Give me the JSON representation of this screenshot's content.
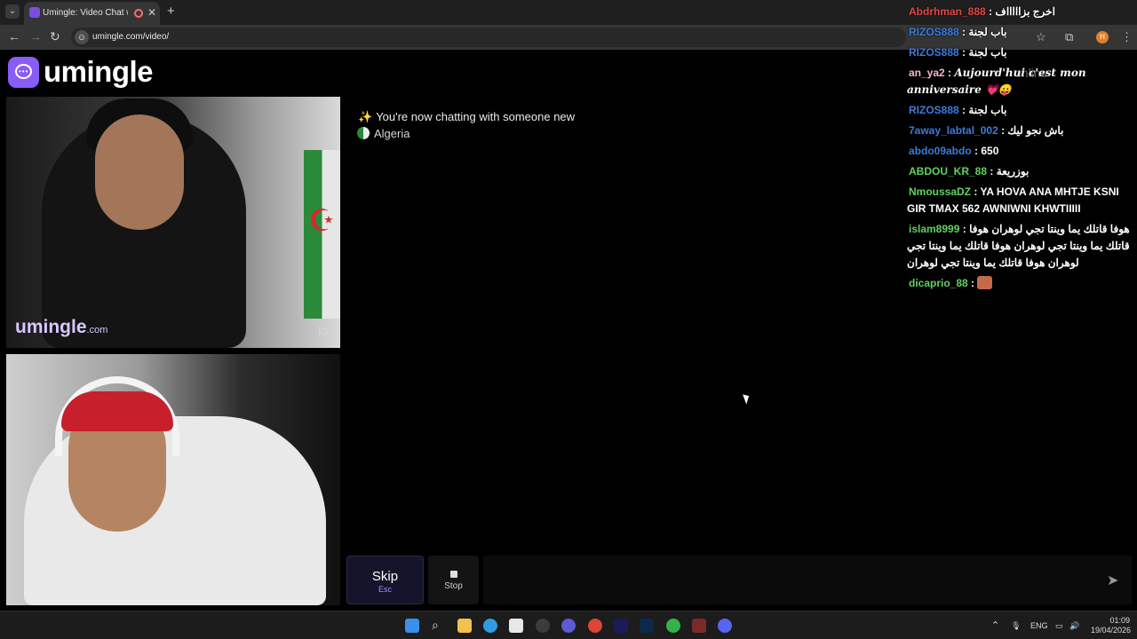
{
  "browser": {
    "tab_title": "Umingle: Video Chat with S",
    "url": "umingle.com/video/",
    "profile_initial": "H"
  },
  "page": {
    "logo_text": "umingle",
    "online_label": "online",
    "video_brand": "umingle",
    "video_brand_suffix": ".com",
    "chat_header": "You're now chatting with someone new",
    "country": "Algeria",
    "skip_label": "Skip",
    "skip_key": "Esc",
    "stop_label": "Stop",
    "message_placeholder": ""
  },
  "feed": [
    {
      "user": "Abdrhman_888",
      "user_color": "#e04848",
      "text": "اخرج بزاااااف"
    },
    {
      "user": "RIZOS888",
      "user_color": "#3b7bdc",
      "text": "باب لجنة"
    },
    {
      "user": "RIZOS888",
      "user_color": "#3b7bdc",
      "text": "باب لجنة"
    },
    {
      "user": "an_ya2",
      "user_color": "#f2b8c6",
      "text": "Aujourd'hui c'est mon anniversaire 💗😛",
      "cursive": true
    },
    {
      "user": "RIZOS888",
      "user_color": "#3b7bdc",
      "text": "باب لجنة"
    },
    {
      "user": "7away_labtal_002",
      "user_color": "#3b7bdc",
      "text": "باش نجو ليك"
    },
    {
      "user": "abdo09abdo",
      "user_color": "#3b7bdc",
      "text": "650"
    },
    {
      "user": "ABDOU_KR_88",
      "user_color": "#5fd35f",
      "text": "بوزريعة"
    },
    {
      "user": "NmoussaDZ",
      "user_color": "#5fd35f",
      "text": "YA HOVA ANA MHTJE KSNI GIR TMAX 562 AWNIWNI KHWTIIIII"
    },
    {
      "user": "islam8999",
      "user_color": "#5fd35f",
      "text": "هوفا قاتلك يما وينتا تجي لوهران هوفا قاتلك يما وينتا تجي لوهران هوفا قاتلك يما وينتا تجي لوهران هوفا قاتلك يما وينتا تجي لوهران"
    },
    {
      "user": "dicaprio_88",
      "user_color": "#5fd35f",
      "text": "",
      "emote": true
    }
  ],
  "taskbar": {
    "lang": "ENG",
    "time": "01:09",
    "date": "19/04/2026"
  },
  "colors": {
    "accent": "#8a5cf6",
    "skip_bg": "#14142a"
  }
}
